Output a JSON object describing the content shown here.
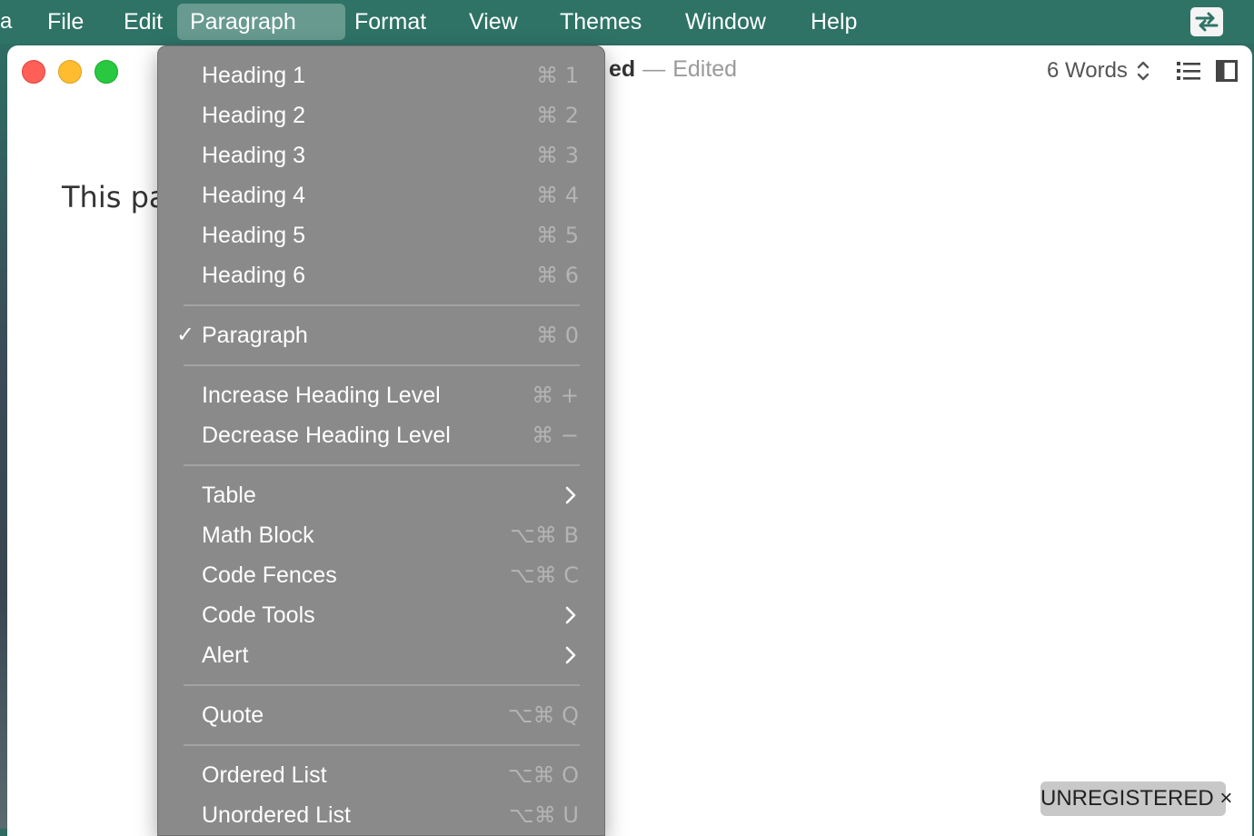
{
  "menubar": {
    "app_tail": "a",
    "items": [
      {
        "label": "File"
      },
      {
        "label": "Edit"
      },
      {
        "label": "Paragraph"
      },
      {
        "label": "Format"
      },
      {
        "label": "View"
      },
      {
        "label": "Themes"
      },
      {
        "label": "Window"
      },
      {
        "label": "Help"
      }
    ],
    "active_item": "Paragraph",
    "tray_icon": "arrows-swap-icon"
  },
  "window": {
    "title_fragment": "ed",
    "title_dash": "—",
    "title_status": "Edited",
    "word_count": "6 Words",
    "document_text": "This pa",
    "badge": "UNREGISTERED ×"
  },
  "paragraph_menu": {
    "items": [
      {
        "label": "Heading 1",
        "shortcut": "⌘ 1"
      },
      {
        "label": "Heading 2",
        "shortcut": "⌘ 2"
      },
      {
        "label": "Heading 3",
        "shortcut": "⌘ 3"
      },
      {
        "label": "Heading 4",
        "shortcut": "⌘ 4"
      },
      {
        "label": "Heading 5",
        "shortcut": "⌘ 5"
      },
      {
        "label": "Heading 6",
        "shortcut": "⌘ 6"
      },
      {
        "label": "Paragraph",
        "shortcut": "⌘ 0",
        "checked": true,
        "check": "✓"
      },
      {
        "label": "Increase Heading Level",
        "shortcut": "⌘ +"
      },
      {
        "label": "Decrease Heading Level",
        "shortcut": "⌘ −"
      },
      {
        "label": "Table",
        "submenu": true
      },
      {
        "label": "Math Block",
        "shortcut": "⌥⌘ B"
      },
      {
        "label": "Code Fences",
        "shortcut": "⌥⌘ C"
      },
      {
        "label": "Code Tools",
        "submenu": true
      },
      {
        "label": "Alert",
        "submenu": true
      },
      {
        "label": "Quote",
        "shortcut": "⌥⌘ Q"
      },
      {
        "label": "Ordered List",
        "shortcut": "⌥⌘ O"
      },
      {
        "label": "Unordered List",
        "shortcut": "⌥⌘ U"
      }
    ]
  },
  "colors": {
    "menubar": "#2e7366",
    "menu_bg": "#8a8a8a",
    "shortcut_text": "#b4b4b4",
    "close": "#fe5f57",
    "minimize": "#febc2e",
    "zoom": "#28c840"
  }
}
